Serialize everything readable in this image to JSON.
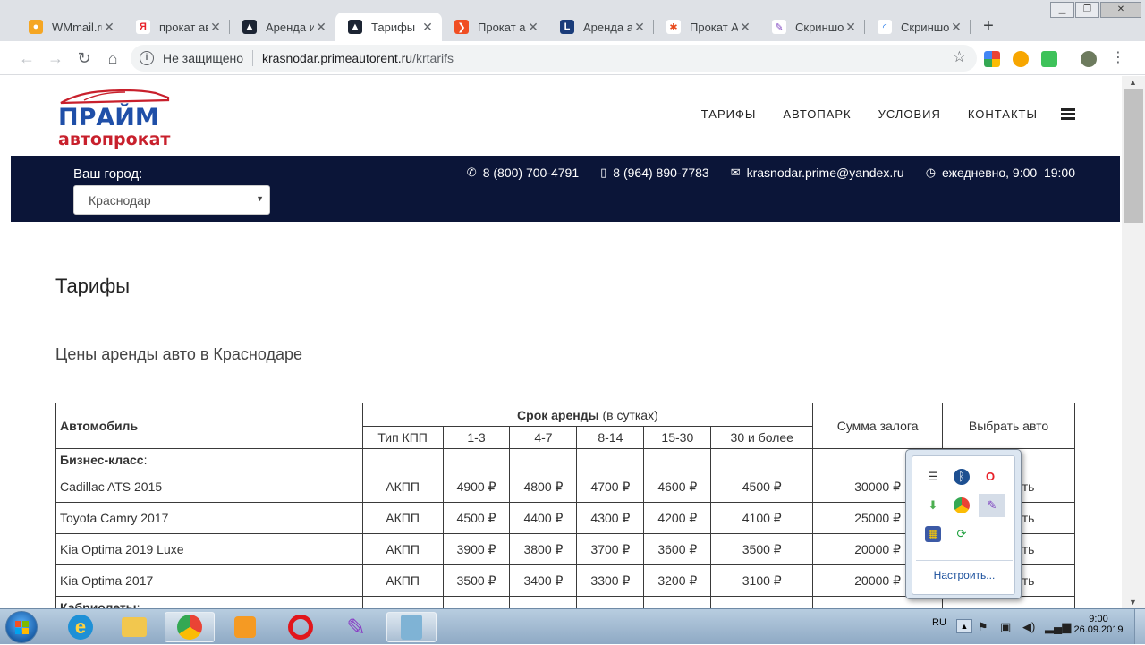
{
  "browser": {
    "tabs": [
      {
        "title": "WMmail.ru",
        "fav_color": "#f5a623",
        "fav_glyph": "●"
      },
      {
        "title": "прокат ав",
        "fav_color": "#ffffff",
        "fav_glyph": "Я",
        "fav_text": "#e8222a"
      },
      {
        "title": "Аренда и",
        "fav_color": "#1c2433",
        "fav_glyph": "▲"
      },
      {
        "title": "Тарифы",
        "fav_color": "#1c2433",
        "fav_glyph": "▲",
        "active": true
      },
      {
        "title": "Прокат ав",
        "fav_color": "#f04e23",
        "fav_glyph": "❯"
      },
      {
        "title": "Аренда ав",
        "fav_color": "#1a3c7a",
        "fav_glyph": "L"
      },
      {
        "title": "Прокат А",
        "fav_color": "#ffffff",
        "fav_glyph": "✱",
        "fav_text": "#e84a1c"
      },
      {
        "title": "Скриншо",
        "fav_color": "#ffffff",
        "fav_glyph": "✎",
        "fav_text": "#7b3fbf"
      },
      {
        "title": "Скриншо",
        "fav_color": "#ffffff",
        "fav_glyph": "◜",
        "fav_text": "#1a73e8"
      }
    ],
    "security_label": "Не защищено",
    "url_host": "krasnodar.primeautorent.ru",
    "url_path": "/krtarifs"
  },
  "site": {
    "logo_top": "ПРАЙМ",
    "logo_bottom": "автопрокат",
    "nav": [
      "ТАРИФЫ",
      "АВТОПАРК",
      "УСЛОВИЯ",
      "КОНТАКТЫ"
    ],
    "city_label": "Ваш город:",
    "city_value": "Краснодар",
    "phone1": "8 (800) 700-4791",
    "phone2": "8 (964) 890-7783",
    "email": "krasnodar.prime@yandex.ru",
    "hours": "ежедневно, 9:00–19:00"
  },
  "content": {
    "title": "Тарифы",
    "subtitle": "Цены аренды авто в Краснодаре",
    "table": {
      "h_car": "Автомобиль",
      "h_term": "Срок аренды",
      "h_term_unit": "(в сутках)",
      "h_deposit": "Сумма залога",
      "h_choose": "Выбрать авто",
      "h_gear": "Тип КПП",
      "periods": [
        "1-3",
        "4-7",
        "8-14",
        "15-30",
        "30 и более"
      ],
      "group1": "Бизнес-класс",
      "rows": [
        {
          "car": "Cadillac ATS 2015",
          "gear": "АКПП",
          "p": [
            "4900 ₽",
            "4800 ₽",
            "4700 ₽",
            "4600 ₽",
            "4500 ₽"
          ],
          "deposit": "30000 ₽",
          "action": "Заказать"
        },
        {
          "car": "Toyota Camry 2017",
          "gear": "АКПП",
          "p": [
            "4500 ₽",
            "4400 ₽",
            "4300 ₽",
            "4200 ₽",
            "4100 ₽"
          ],
          "deposit": "25000 ₽",
          "action": "Заказать"
        },
        {
          "car": "Kia Optima 2019 Luxe",
          "gear": "АКПП",
          "p": [
            "3900 ₽",
            "3800 ₽",
            "3700 ₽",
            "3600 ₽",
            "3500 ₽"
          ],
          "deposit": "20000 ₽",
          "action": "Заказать"
        },
        {
          "car": "Kia Optima 2017",
          "gear": "АКПП",
          "p": [
            "3500 ₽",
            "3400 ₽",
            "3300 ₽",
            "3200 ₽",
            "3100 ₽"
          ],
          "deposit": "20000 ₽",
          "action": "Заказать"
        }
      ],
      "group2": "Кабриолеты"
    }
  },
  "tray_popup": {
    "customize": "Настроить..."
  },
  "taskbar": {
    "lang": "RU",
    "time": "9:00",
    "date": "26.09.2019"
  },
  "colors": {
    "brand_blue": "#1f4fa8",
    "brand_red": "#c8202c",
    "topbar": "#0b1538"
  }
}
